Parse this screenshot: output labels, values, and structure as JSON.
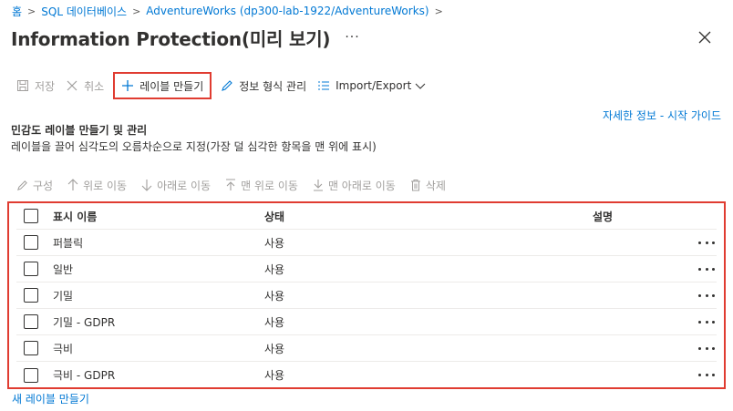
{
  "breadcrumb": {
    "items": [
      "홈",
      "SQL 데이터베이스",
      "AdventureWorks (dp300-lab-1922/AdventureWorks)"
    ]
  },
  "page": {
    "title": "Information Protection(미리 보기)",
    "more": "···"
  },
  "toolbar": {
    "save": "저장",
    "cancel": "취소",
    "create_label": "레이블 만들기",
    "manage_info_types": "정보 형식 관리",
    "import_export": "Import/Export"
  },
  "help_link": "자세한 정보 - 시작 가이드",
  "section": {
    "title": "민감도 레이블 만들기 및 관리",
    "description": "레이블을 끌어 심각도의 오름차순으로 지정(가장 덜 심각한 항목을 맨 위에 표시)"
  },
  "subtoolbar": {
    "configure": "구성",
    "move_up": "위로 이동",
    "move_down": "아래로 이동",
    "move_top": "맨 위로 이동",
    "move_bottom": "맨 아래로 이동",
    "delete": "삭제"
  },
  "table": {
    "columns": [
      "표시 이름",
      "상태",
      "설명"
    ],
    "rows": [
      {
        "name": "퍼블릭",
        "status": "사용",
        "description": ""
      },
      {
        "name": "일반",
        "status": "사용",
        "description": ""
      },
      {
        "name": "기밀",
        "status": "사용",
        "description": ""
      },
      {
        "name": "기밀 - GDPR",
        "status": "사용",
        "description": ""
      },
      {
        "name": "극비",
        "status": "사용",
        "description": ""
      },
      {
        "name": "극비 - GDPR",
        "status": "사용",
        "description": ""
      }
    ]
  },
  "new_label_link": "새 레이블 만들기",
  "colors": {
    "accent": "#0078d4",
    "highlight_border": "#e03c31",
    "disabled": "#a19f9d",
    "text": "#323130"
  }
}
